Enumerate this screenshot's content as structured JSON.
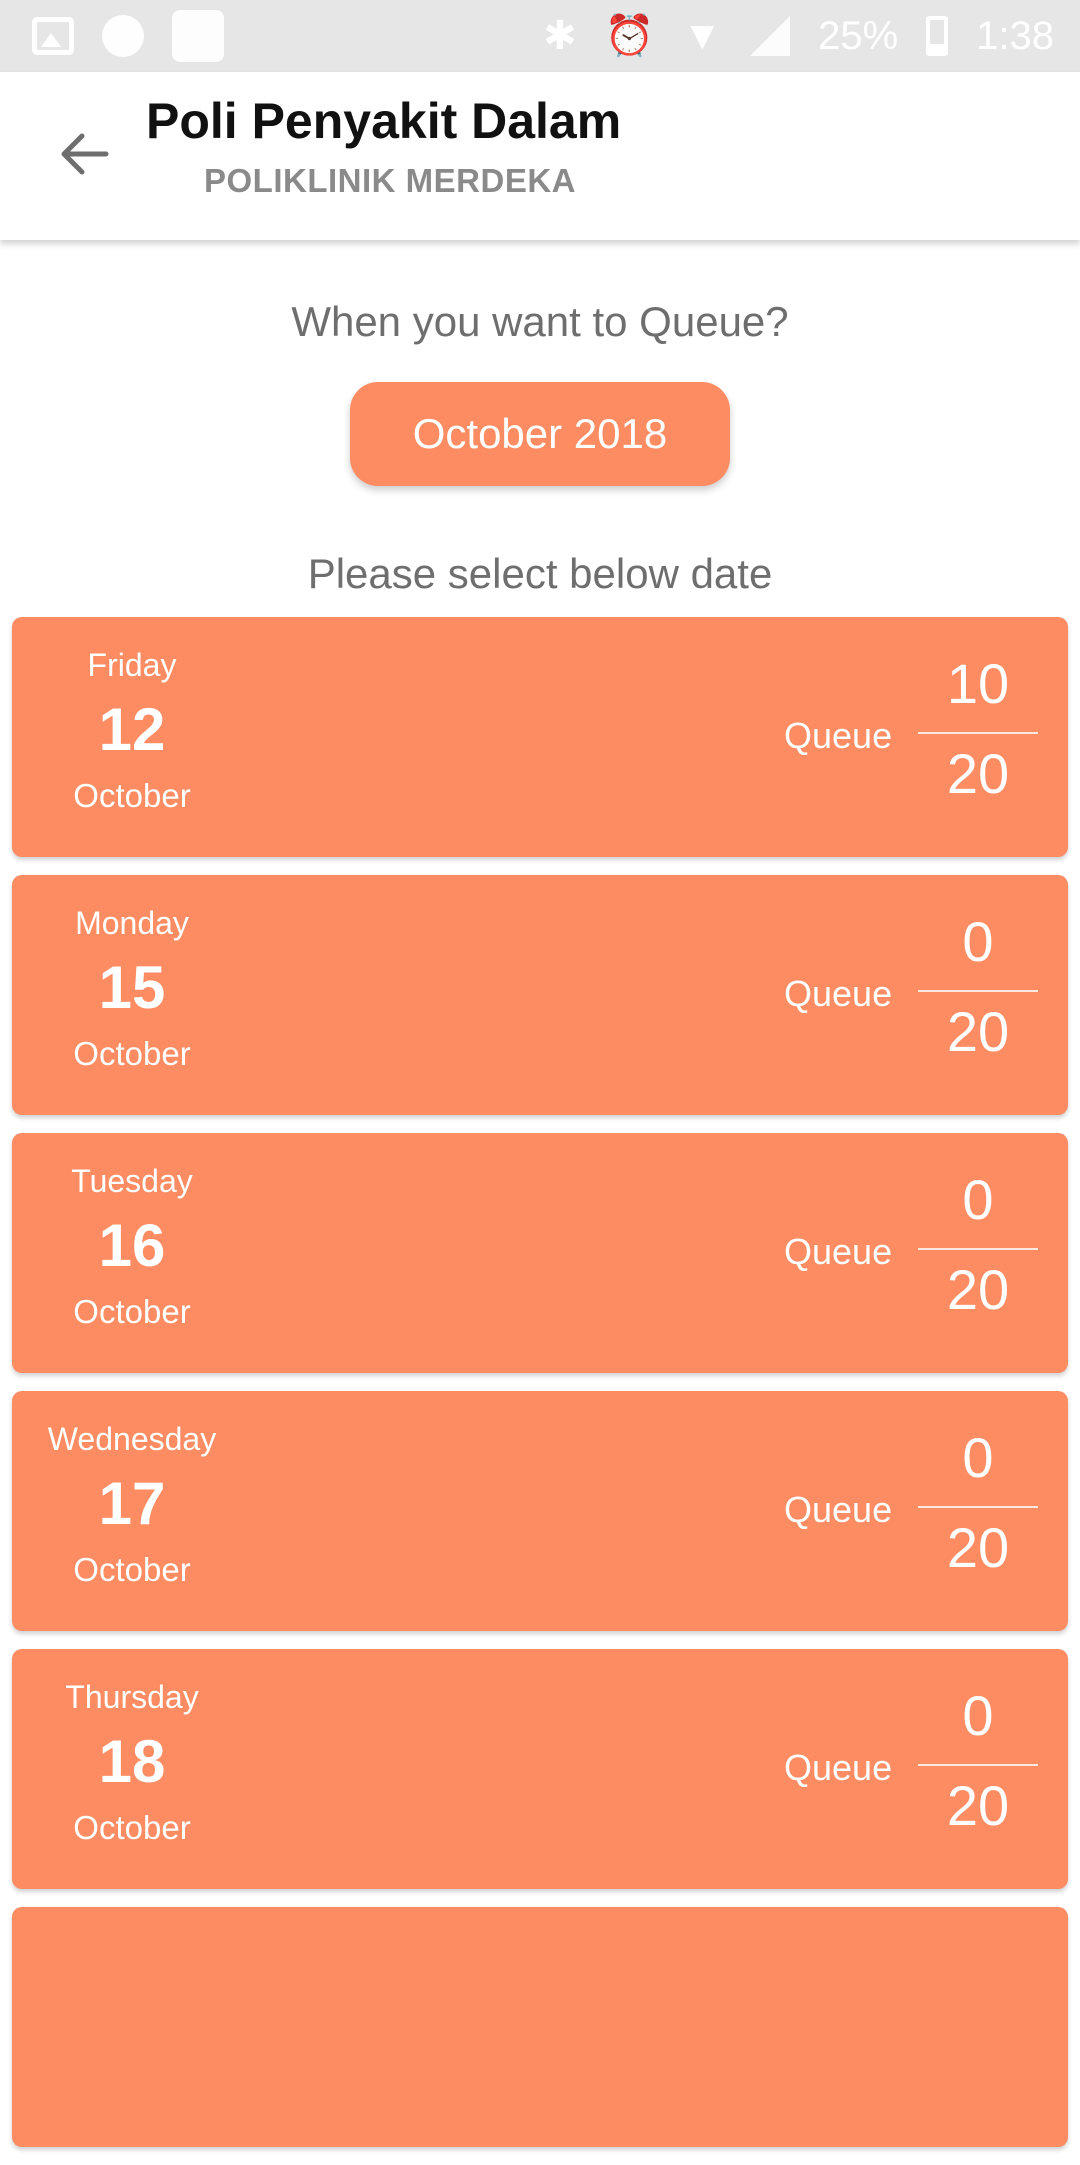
{
  "status_bar": {
    "icons": [
      "image-icon",
      "circle-app-icon",
      "grid-app-icon",
      "bluetooth-icon",
      "alarm-icon",
      "wifi-icon",
      "signal-icon",
      "battery-icon"
    ],
    "battery": "25%",
    "time": "1:38"
  },
  "header": {
    "title": "Poli Penyakit Dalam",
    "subtitle": "POLIKLINIK MERDEKA",
    "back_icon": "arrow-left-icon"
  },
  "main": {
    "question": "When you want to Queue?",
    "month_button": "October 2018",
    "instruction": "Please select below date"
  },
  "dates": [
    {
      "day": "Friday",
      "date": "12",
      "month": "October",
      "queue_label": "Queue",
      "queue_current": "10",
      "queue_total": "20"
    },
    {
      "day": "Monday",
      "date": "15",
      "month": "October",
      "queue_label": "Queue",
      "queue_current": "0",
      "queue_total": "20"
    },
    {
      "day": "Tuesday",
      "date": "16",
      "month": "October",
      "queue_label": "Queue",
      "queue_current": "0",
      "queue_total": "20"
    },
    {
      "day": "Wednesday",
      "date": "17",
      "month": "October",
      "queue_label": "Queue",
      "queue_current": "0",
      "queue_total": "20"
    },
    {
      "day": "Thursday",
      "date": "18",
      "month": "October",
      "queue_label": "Queue",
      "queue_current": "0",
      "queue_total": "20"
    }
  ],
  "colors": {
    "accent": "#fd8c63",
    "status_bar": "#e6e6e6",
    "text_gray": "#6e6e6e"
  }
}
